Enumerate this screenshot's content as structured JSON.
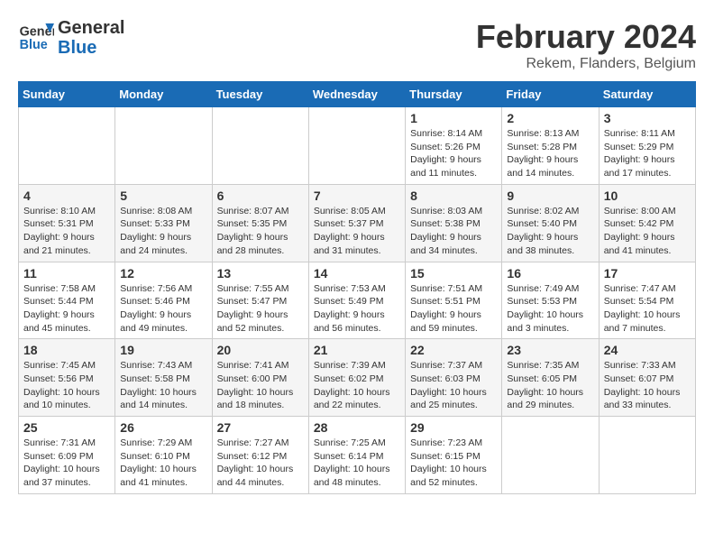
{
  "header": {
    "logo_line1": "General",
    "logo_line2": "Blue",
    "month": "February 2024",
    "location": "Rekem, Flanders, Belgium"
  },
  "weekdays": [
    "Sunday",
    "Monday",
    "Tuesday",
    "Wednesday",
    "Thursday",
    "Friday",
    "Saturday"
  ],
  "weeks": [
    [
      {
        "day": "",
        "info": ""
      },
      {
        "day": "",
        "info": ""
      },
      {
        "day": "",
        "info": ""
      },
      {
        "day": "",
        "info": ""
      },
      {
        "day": "1",
        "info": "Sunrise: 8:14 AM\nSunset: 5:26 PM\nDaylight: 9 hours\nand 11 minutes."
      },
      {
        "day": "2",
        "info": "Sunrise: 8:13 AM\nSunset: 5:28 PM\nDaylight: 9 hours\nand 14 minutes."
      },
      {
        "day": "3",
        "info": "Sunrise: 8:11 AM\nSunset: 5:29 PM\nDaylight: 9 hours\nand 17 minutes."
      }
    ],
    [
      {
        "day": "4",
        "info": "Sunrise: 8:10 AM\nSunset: 5:31 PM\nDaylight: 9 hours\nand 21 minutes."
      },
      {
        "day": "5",
        "info": "Sunrise: 8:08 AM\nSunset: 5:33 PM\nDaylight: 9 hours\nand 24 minutes."
      },
      {
        "day": "6",
        "info": "Sunrise: 8:07 AM\nSunset: 5:35 PM\nDaylight: 9 hours\nand 28 minutes."
      },
      {
        "day": "7",
        "info": "Sunrise: 8:05 AM\nSunset: 5:37 PM\nDaylight: 9 hours\nand 31 minutes."
      },
      {
        "day": "8",
        "info": "Sunrise: 8:03 AM\nSunset: 5:38 PM\nDaylight: 9 hours\nand 34 minutes."
      },
      {
        "day": "9",
        "info": "Sunrise: 8:02 AM\nSunset: 5:40 PM\nDaylight: 9 hours\nand 38 minutes."
      },
      {
        "day": "10",
        "info": "Sunrise: 8:00 AM\nSunset: 5:42 PM\nDaylight: 9 hours\nand 41 minutes."
      }
    ],
    [
      {
        "day": "11",
        "info": "Sunrise: 7:58 AM\nSunset: 5:44 PM\nDaylight: 9 hours\nand 45 minutes."
      },
      {
        "day": "12",
        "info": "Sunrise: 7:56 AM\nSunset: 5:46 PM\nDaylight: 9 hours\nand 49 minutes."
      },
      {
        "day": "13",
        "info": "Sunrise: 7:55 AM\nSunset: 5:47 PM\nDaylight: 9 hours\nand 52 minutes."
      },
      {
        "day": "14",
        "info": "Sunrise: 7:53 AM\nSunset: 5:49 PM\nDaylight: 9 hours\nand 56 minutes."
      },
      {
        "day": "15",
        "info": "Sunrise: 7:51 AM\nSunset: 5:51 PM\nDaylight: 9 hours\nand 59 minutes."
      },
      {
        "day": "16",
        "info": "Sunrise: 7:49 AM\nSunset: 5:53 PM\nDaylight: 10 hours\nand 3 minutes."
      },
      {
        "day": "17",
        "info": "Sunrise: 7:47 AM\nSunset: 5:54 PM\nDaylight: 10 hours\nand 7 minutes."
      }
    ],
    [
      {
        "day": "18",
        "info": "Sunrise: 7:45 AM\nSunset: 5:56 PM\nDaylight: 10 hours\nand 10 minutes."
      },
      {
        "day": "19",
        "info": "Sunrise: 7:43 AM\nSunset: 5:58 PM\nDaylight: 10 hours\nand 14 minutes."
      },
      {
        "day": "20",
        "info": "Sunrise: 7:41 AM\nSunset: 6:00 PM\nDaylight: 10 hours\nand 18 minutes."
      },
      {
        "day": "21",
        "info": "Sunrise: 7:39 AM\nSunset: 6:02 PM\nDaylight: 10 hours\nand 22 minutes."
      },
      {
        "day": "22",
        "info": "Sunrise: 7:37 AM\nSunset: 6:03 PM\nDaylight: 10 hours\nand 25 minutes."
      },
      {
        "day": "23",
        "info": "Sunrise: 7:35 AM\nSunset: 6:05 PM\nDaylight: 10 hours\nand 29 minutes."
      },
      {
        "day": "24",
        "info": "Sunrise: 7:33 AM\nSunset: 6:07 PM\nDaylight: 10 hours\nand 33 minutes."
      }
    ],
    [
      {
        "day": "25",
        "info": "Sunrise: 7:31 AM\nSunset: 6:09 PM\nDaylight: 10 hours\nand 37 minutes."
      },
      {
        "day": "26",
        "info": "Sunrise: 7:29 AM\nSunset: 6:10 PM\nDaylight: 10 hours\nand 41 minutes."
      },
      {
        "day": "27",
        "info": "Sunrise: 7:27 AM\nSunset: 6:12 PM\nDaylight: 10 hours\nand 44 minutes."
      },
      {
        "day": "28",
        "info": "Sunrise: 7:25 AM\nSunset: 6:14 PM\nDaylight: 10 hours\nand 48 minutes."
      },
      {
        "day": "29",
        "info": "Sunrise: 7:23 AM\nSunset: 6:15 PM\nDaylight: 10 hours\nand 52 minutes."
      },
      {
        "day": "",
        "info": ""
      },
      {
        "day": "",
        "info": ""
      }
    ]
  ]
}
